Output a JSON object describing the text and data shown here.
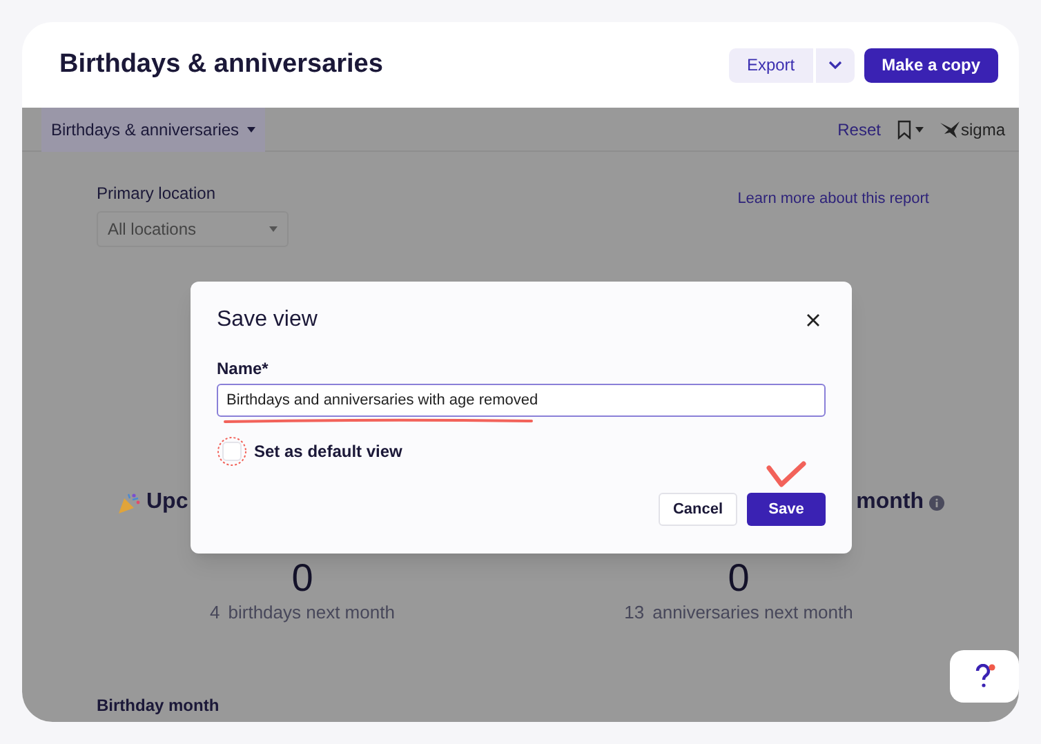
{
  "header": {
    "title": "Birthdays & anniversaries",
    "export_button": "Export",
    "copy_button": "Make a copy"
  },
  "toolbar": {
    "view_tab": {
      "label": "Birthdays & anniversaries",
      "selected": true
    },
    "reset": "Reset",
    "brand": "sigma"
  },
  "filter": {
    "label": "Primary location",
    "value": "All locations"
  },
  "link": "Learn more about this report",
  "stats": [
    {
      "heading": "Upc",
      "value": "0",
      "count": "4",
      "caption": "birthdays next month"
    },
    {
      "heading": "month",
      "value": "0",
      "count": "13",
      "caption": "anniversaries next month"
    }
  ],
  "section_title": "Birthday month",
  "dialog": {
    "title": "Save view",
    "field_label": "Name*",
    "field_value": "Birthdays and anniversaries with age removed",
    "default_checkbox": {
      "label": "Set as default view",
      "checked": false
    },
    "cancel": "Cancel",
    "save": "Save"
  }
}
